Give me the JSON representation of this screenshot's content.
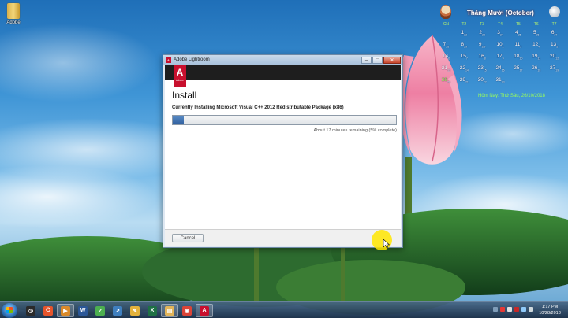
{
  "desktop": {
    "icon_label": "Adobe"
  },
  "calendar": {
    "month_title": "Tháng Mười (October)",
    "weekdays": [
      "CN",
      "T2",
      "T3",
      "T4",
      "T5",
      "T6",
      "T7"
    ],
    "weeks": [
      [
        {
          "d": "",
          "l": ""
        },
        {
          "d": "1",
          "l": "22"
        },
        {
          "d": "2",
          "l": "23"
        },
        {
          "d": "3",
          "l": "24"
        },
        {
          "d": "4",
          "l": "25"
        },
        {
          "d": "5",
          "l": "26"
        },
        {
          "d": "6",
          "l": "27"
        }
      ],
      [
        {
          "d": "7",
          "l": "28"
        },
        {
          "d": "8",
          "l": "29"
        },
        {
          "d": "9",
          "l": "1/9"
        },
        {
          "d": "10",
          "l": "2"
        },
        {
          "d": "11",
          "l": "3"
        },
        {
          "d": "12",
          "l": "4"
        },
        {
          "d": "13",
          "l": "5"
        }
      ],
      [
        {
          "d": "14",
          "l": "6"
        },
        {
          "d": "15",
          "l": "7"
        },
        {
          "d": "16",
          "l": "8"
        },
        {
          "d": "17",
          "l": "9"
        },
        {
          "d": "18",
          "l": "10"
        },
        {
          "d": "19",
          "l": "11"
        },
        {
          "d": "20",
          "l": "12"
        }
      ],
      [
        {
          "d": "21",
          "l": "13"
        },
        {
          "d": "22",
          "l": "14"
        },
        {
          "d": "23",
          "l": "15"
        },
        {
          "d": "24",
          "l": "16"
        },
        {
          "d": "25",
          "l": "17"
        },
        {
          "d": "26",
          "l": "18"
        },
        {
          "d": "27",
          "l": "19"
        }
      ],
      [
        {
          "d": "28",
          "l": "20"
        },
        {
          "d": "29",
          "l": "21"
        },
        {
          "d": "30",
          "l": "22"
        },
        {
          "d": "31",
          "l": "23"
        },
        {
          "d": "",
          "l": ""
        },
        {
          "d": "",
          "l": ""
        },
        {
          "d": "",
          "l": ""
        }
      ]
    ],
    "today_day": "28",
    "footer_text": "Hôm Nay: Thứ Sáu, 26/10/2018"
  },
  "window": {
    "title": "Adobe Lightroom",
    "controls": {
      "minimize": "–",
      "maximize": "□",
      "close": "✕"
    },
    "logo_letter": "A",
    "logo_word": "Adobe",
    "heading": "Install",
    "status_text": "Currently Installing Microsoft Visual C++ 2012 Redistributable Package (x86)",
    "progress_percent": 5,
    "remaining_text": "About 17 minutes remaining (5% complete)",
    "cancel_label": "Cancel"
  },
  "taskbar": {
    "items": [
      {
        "name": "clock-app",
        "glyph": "◷",
        "color": "#2a2a2a",
        "active": false
      },
      {
        "name": "power",
        "glyph": "⏻",
        "color": "#e5542c",
        "active": false
      },
      {
        "name": "media-player",
        "glyph": "▶",
        "color": "#d98a2b",
        "active": true
      },
      {
        "name": "word",
        "glyph": "W",
        "color": "#2b5797",
        "active": false
      },
      {
        "name": "app-green",
        "glyph": "✓",
        "color": "#4caf50",
        "active": false
      },
      {
        "name": "chart-app",
        "glyph": "↗",
        "color": "#3f7fbf",
        "active": false
      },
      {
        "name": "notes",
        "glyph": "✎",
        "color": "#e3b23c",
        "active": false
      },
      {
        "name": "excel",
        "glyph": "X",
        "color": "#1e7145",
        "active": false
      },
      {
        "name": "explorer",
        "glyph": "▤",
        "color": "#e2b55a",
        "active": true
      },
      {
        "name": "chrome",
        "glyph": "◉",
        "color": "#db4437",
        "active": false
      },
      {
        "name": "adobe",
        "glyph": "A",
        "color": "#c8102e",
        "active": true
      }
    ],
    "time": "1:17 PM",
    "date": "10/28/2018"
  }
}
